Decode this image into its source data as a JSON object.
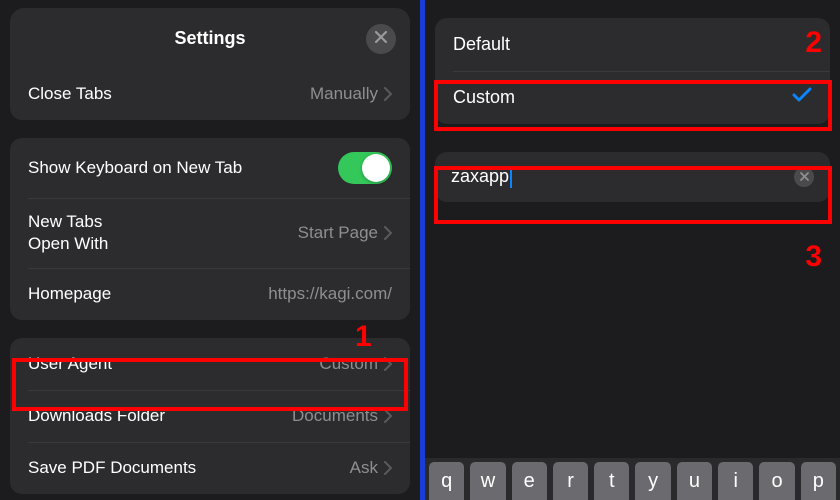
{
  "header": {
    "title": "Settings"
  },
  "settings": {
    "close_tabs": {
      "label": "Close Tabs",
      "value": "Manually"
    },
    "show_keyboard": {
      "label": "Show Keyboard on New Tab",
      "on": true
    },
    "new_tabs": {
      "label1": "New Tabs",
      "label2": "Open With",
      "value": "Start Page"
    },
    "homepage": {
      "label": "Homepage",
      "value": "https://kagi.com/"
    },
    "user_agent": {
      "label": "User Agent",
      "value": "Custom"
    },
    "downloads": {
      "label": "Downloads Folder",
      "value": "Documents"
    },
    "save_pdf": {
      "label": "Save PDF Documents",
      "value": "Ask"
    }
  },
  "ua_options": {
    "default": "Default",
    "custom": "Custom"
  },
  "ua_input": {
    "value": "zaxapp"
  },
  "keyboard_row": [
    "q",
    "w",
    "e",
    "r",
    "t",
    "y",
    "u",
    "i",
    "o",
    "p"
  ],
  "annotations": {
    "n1": "1",
    "n2": "2",
    "n3": "3"
  }
}
